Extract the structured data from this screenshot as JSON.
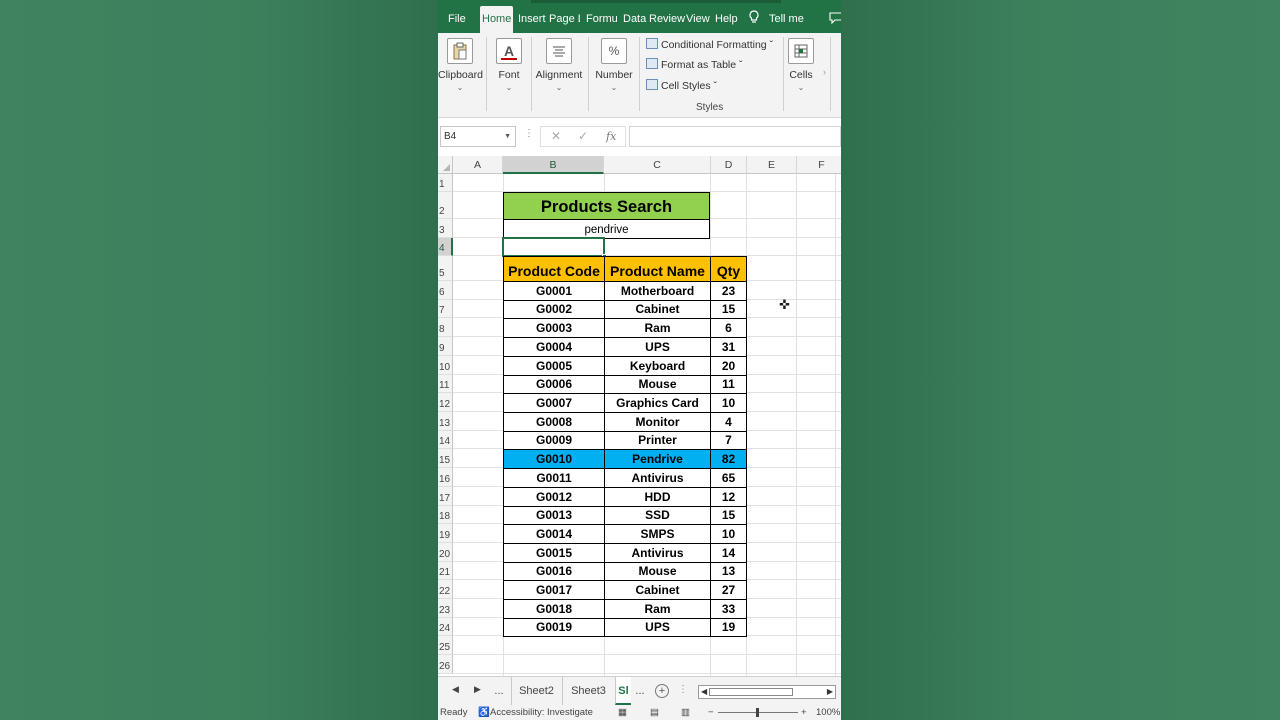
{
  "ribbon_tabs": {
    "file": "File",
    "home": "Home",
    "insert": "Insert",
    "page_layout": "Page Li",
    "formulas": "Formul",
    "data": "Data",
    "review": "Review",
    "view": "View",
    "help": "Help",
    "tell_me": "Tell me"
  },
  "ribbon": {
    "clipboard": "Clipboard",
    "font": "Font",
    "alignment": "Alignment",
    "number": "Number",
    "conditional_formatting": "Conditional Formatting ˇ",
    "format_as_table": "Format as Table ˇ",
    "cell_styles": "Cell Styles ˇ",
    "styles": "Styles",
    "cells": "Cells"
  },
  "formula_bar": {
    "name_box": "B4",
    "fx": "fx",
    "content": ""
  },
  "columns": [
    "A",
    "B",
    "C",
    "D",
    "E",
    "F"
  ],
  "rows": [
    "1",
    "2",
    "3",
    "4",
    "5",
    "6",
    "7",
    "8",
    "9",
    "10",
    "11",
    "12",
    "13",
    "14",
    "15",
    "16",
    "17",
    "18",
    "19",
    "20",
    "21",
    "22",
    "23",
    "24",
    "25",
    "26"
  ],
  "sheet": {
    "title": "Products Search",
    "search_value": "pendrive",
    "headers": {
      "code": "Product Code",
      "name": "Product Name",
      "qty": "Qty"
    },
    "products": [
      {
        "code": "G0001",
        "name": "Motherboard",
        "qty": "23"
      },
      {
        "code": "G0002",
        "name": "Cabinet",
        "qty": "15"
      },
      {
        "code": "G0003",
        "name": "Ram",
        "qty": "6"
      },
      {
        "code": "G0004",
        "name": "UPS",
        "qty": "31"
      },
      {
        "code": "G0005",
        "name": "Keyboard",
        "qty": "20"
      },
      {
        "code": "G0006",
        "name": "Mouse",
        "qty": "11"
      },
      {
        "code": "G0007",
        "name": "Graphics Card",
        "qty": "10"
      },
      {
        "code": "G0008",
        "name": "Monitor",
        "qty": "4"
      },
      {
        "code": "G0009",
        "name": "Printer",
        "qty": "7"
      },
      {
        "code": "G0010",
        "name": "Pendrive",
        "qty": "82"
      },
      {
        "code": "G0011",
        "name": "Antivirus",
        "qty": "65"
      },
      {
        "code": "G0012",
        "name": "HDD",
        "qty": "12"
      },
      {
        "code": "G0013",
        "name": "SSD",
        "qty": "15"
      },
      {
        "code": "G0014",
        "name": "SMPS",
        "qty": "10"
      },
      {
        "code": "G0015",
        "name": "Antivirus",
        "qty": "14"
      },
      {
        "code": "G0016",
        "name": "Mouse",
        "qty": "13"
      },
      {
        "code": "G0017",
        "name": "Cabinet",
        "qty": "27"
      },
      {
        "code": "G0018",
        "name": "Ram",
        "qty": "33"
      },
      {
        "code": "G0019",
        "name": "UPS",
        "qty": "19"
      }
    ],
    "highlight_row": "G0010"
  },
  "sheet_tabs": {
    "ellipsis": "...",
    "sheet2": "Sheet2",
    "sheet3": "Sheet3",
    "active": "Sl",
    "ellipsis2": "...",
    "add": "+"
  },
  "status_bar": {
    "ready": "Ready",
    "accessibility": "Accessibility: Investigate",
    "zoom": "100%"
  },
  "colors": {
    "excel_green": "#217346",
    "title_fill": "#92d050",
    "header_fill": "#ffc000",
    "highlight_fill": "#00b0f0"
  }
}
